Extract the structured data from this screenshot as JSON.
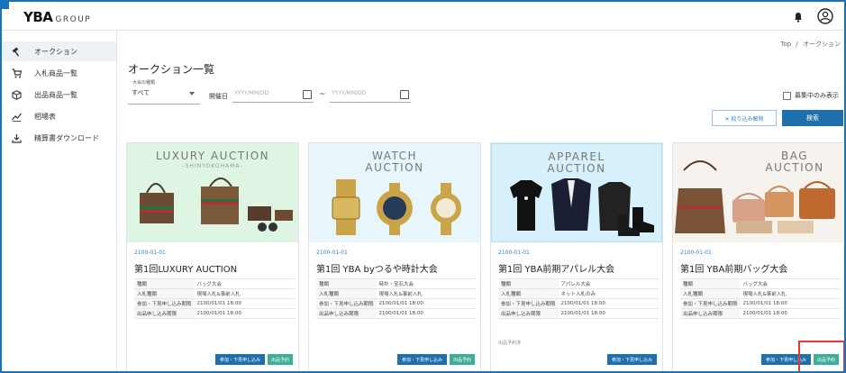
{
  "app": {
    "logo_main": "YBA",
    "logo_sub": "GROUP"
  },
  "sidebar": {
    "items": [
      {
        "label": "オークション",
        "icon": "gavel-icon"
      },
      {
        "label": "入札商品一覧",
        "icon": "cart-icon"
      },
      {
        "label": "出品商品一覧",
        "icon": "box-icon"
      },
      {
        "label": "相場表",
        "icon": "trend-chart-icon"
      },
      {
        "label": "精算書ダウンロード",
        "icon": "download-icon"
      }
    ]
  },
  "breadcrumb": {
    "home": "Top",
    "separator": "/",
    "current": "オークション"
  },
  "page": {
    "title": "オークション一覧"
  },
  "filters": {
    "type_label": "大会の種類",
    "type_value": "すべて",
    "date_label": "開催日",
    "date_from_placeholder": "YYYY/MM/DD",
    "date_to_placeholder": "YYYY/MM/DD",
    "range_separator": "~",
    "recruiting_only_label": "募集中のみ表示",
    "clear_label": "✕ 絞り込み解除",
    "search_label": "検索"
  },
  "cards": [
    {
      "banner": "LUXURY AUCTION",
      "banner_sub": "-SHINYOKOHAMA-",
      "bg": "#dff5e4",
      "date": "2100-01-01",
      "title": "第1回LUXURY AUCTION",
      "rows": [
        {
          "k": "種類",
          "v": "バッグ大会"
        },
        {
          "k": "入札種類",
          "v": "現場入札&事前入札"
        },
        {
          "k": "参加・下見申し込み期限",
          "v": "2100/01/01 18:00"
        },
        {
          "k": "出品申し込み期限",
          "v": "2100/01/01 18:00"
        }
      ],
      "note": "",
      "entry_label": "参加・下見申し込み",
      "reserve_label": "出品予約"
    },
    {
      "banner": "WATCH",
      "banner2": "AUCTION",
      "bg": "#e8f5fb",
      "date": "2100-01-01",
      "title": "第1回 YBA byつるや時計大会",
      "rows": [
        {
          "k": "種類",
          "v": "時計・宝石大会"
        },
        {
          "k": "入札種類",
          "v": "現場入札&事前入札"
        },
        {
          "k": "参加・下見申し込み期限",
          "v": "2100/01/01 18:00"
        },
        {
          "k": "出品申し込み期限",
          "v": "2100/01/01 18:00"
        }
      ],
      "note": "",
      "entry_label": "参加・下見申し込み",
      "reserve_label": "出品予約"
    },
    {
      "banner": "APPAREL",
      "banner2": "AUCTION",
      "bg": "#d6f1fb",
      "date": "2100-01-01",
      "title": "第1回 YBA前期アパレル大会",
      "rows": [
        {
          "k": "種類",
          "v": "アパレル大会"
        },
        {
          "k": "入札種類",
          "v": "ネット入札のみ"
        },
        {
          "k": "参加・下見申し込み期限",
          "v": "2100/01/01 18:00"
        },
        {
          "k": "出品申し込み期限",
          "v": "2100/01/01 18:00"
        }
      ],
      "note": "出品予約済",
      "entry_label": "参加・下見申し込み",
      "reserve_label": ""
    },
    {
      "banner": "BAG",
      "banner2": "AUCTION",
      "bg": "#f6f3ee",
      "date": "2100-01-01",
      "title": "第1回 YBA前期バッグ大会",
      "rows": [
        {
          "k": "種類",
          "v": "バッグ大会"
        },
        {
          "k": "入札種類",
          "v": "現場入札&事前入札"
        },
        {
          "k": "参加・下見申し込み期限",
          "v": "2100/01/01 18:00"
        },
        {
          "k": "出品申し込み期限",
          "v": "2100/01/01 18:00"
        }
      ],
      "note": "",
      "entry_label": "参加・下見申し込み",
      "reserve_label": "出品予約"
    }
  ],
  "colors": {
    "primary": "#1f6fad",
    "accent_green": "#3cae9a",
    "highlight": "#e53935"
  }
}
